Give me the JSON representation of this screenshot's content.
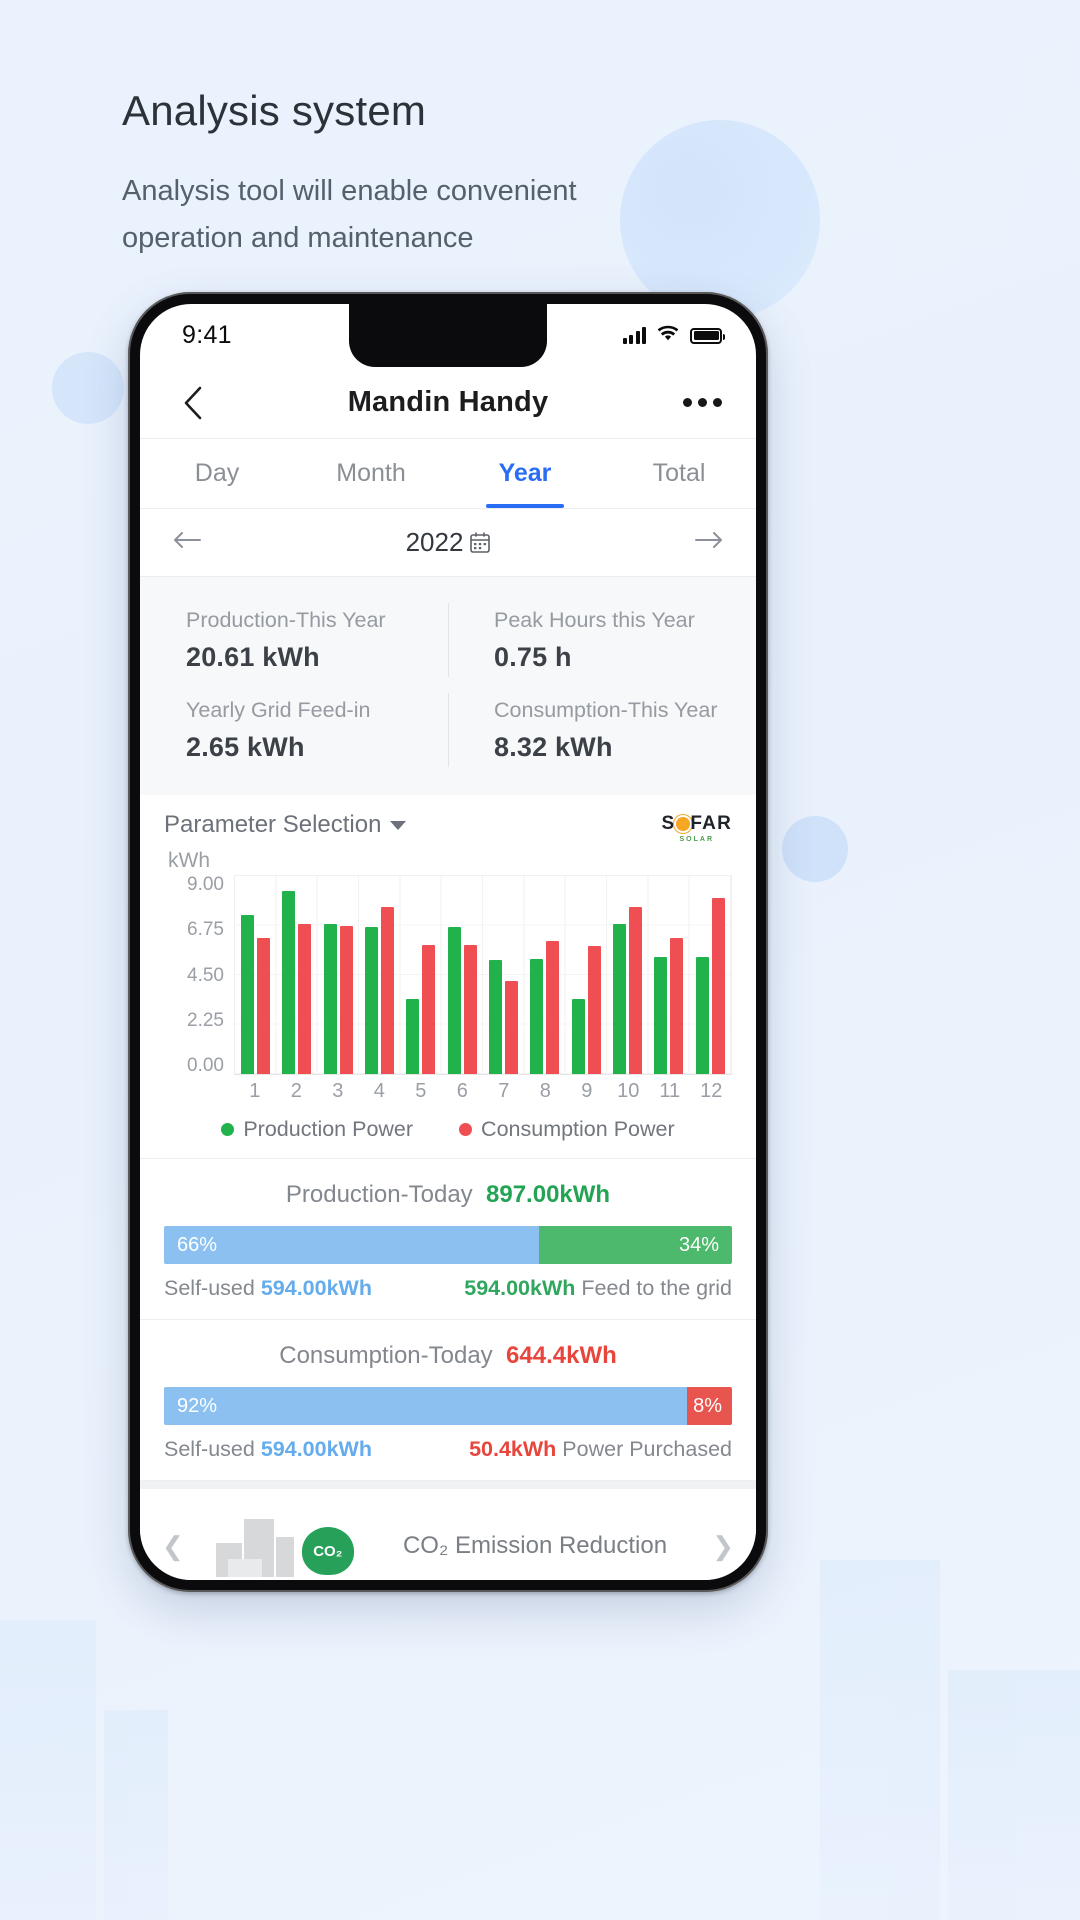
{
  "page": {
    "title": "Analysis system",
    "subtitle": "Analysis tool will enable convenient operation and maintenance"
  },
  "status_bar": {
    "time": "9:41",
    "signal_icon": "cellular-signal-icon",
    "wifi_icon": "wifi-icon",
    "battery_icon": "battery-icon"
  },
  "nav": {
    "back_icon": "chevron-left-icon",
    "title": "Mandin Handy",
    "more_icon": "more-options-icon"
  },
  "tabs": [
    {
      "label": "Day",
      "active": false
    },
    {
      "label": "Month",
      "active": false
    },
    {
      "label": "Year",
      "active": true
    },
    {
      "label": "Total",
      "active": false
    }
  ],
  "date_nav": {
    "prev_icon": "arrow-left-icon",
    "label": "2022",
    "calendar_icon": "calendar-icon",
    "next_icon": "arrow-right-icon"
  },
  "stats": [
    {
      "label": "Production-This Year",
      "value": "20.61 kWh"
    },
    {
      "label": "Peak Hours this Year",
      "value": "0.75 h"
    },
    {
      "label": "Yearly Grid Feed-in",
      "value": "2.65 kWh"
    },
    {
      "label": "Consumption-This Year",
      "value": "8.32 kWh"
    }
  ],
  "chart_section": {
    "parameter_selection": "Parameter Selection",
    "dropdown_icon": "chevron-down-icon",
    "logo_main": "S FAR",
    "logo_sub": "SOLAR",
    "unit": "kWh"
  },
  "chart_data": {
    "type": "bar",
    "title": "",
    "xlabel": "",
    "ylabel": "kWh",
    "ylim": [
      0,
      9.0
    ],
    "yticks": [
      "0.00",
      "2.25",
      "4.50",
      "6.75",
      "9.00"
    ],
    "categories": [
      "1",
      "2",
      "3",
      "4",
      "5",
      "6",
      "7",
      "8",
      "9",
      "10",
      "11",
      "12"
    ],
    "grid": true,
    "legend_position": "bottom",
    "series": [
      {
        "name": "Production Power",
        "color": "#22b24c",
        "values": [
          7.25,
          8.3,
          6.8,
          6.7,
          3.4,
          6.7,
          5.2,
          5.25,
          3.4,
          6.8,
          5.3,
          5.3
        ]
      },
      {
        "name": "Consumption Power",
        "color": "#ef4e52",
        "values": [
          6.2,
          6.8,
          6.75,
          7.6,
          5.85,
          5.85,
          4.25,
          6.05,
          5.8,
          7.6,
          6.2,
          8.0
        ]
      }
    ]
  },
  "production_today": {
    "title": "Production-Today",
    "total": "897.00kWh",
    "self_used_pct": "66%",
    "feed_pct": "34%",
    "self_used_prefix": "Self-used",
    "self_used_value": "594.00kWh",
    "feed_value": "594.00kWh",
    "feed_suffix": "Feed to the grid"
  },
  "consumption_today": {
    "title": "Consumption-Today",
    "total": "644.4kWh",
    "self_used_pct": "92%",
    "purchased_pct": "8%",
    "self_used_prefix": "Self-used",
    "self_used_value": "594.00kWh",
    "purchased_value": "50.4kWh",
    "purchased_suffix": "Power Purchased"
  },
  "co2_section": {
    "label": "CO₂ Emission Reduction",
    "badge_text": "CO₂",
    "prev_icon": "chevron-left-icon",
    "next_icon": "chevron-right-icon"
  },
  "colors": {
    "accent_blue": "#2a6df5",
    "production_green": "#22b24c",
    "consumption_red": "#ef4e52",
    "self_used_blue": "#8bc0f0",
    "feed_green": "#4cb96c",
    "purchased_red": "#e8544e"
  }
}
